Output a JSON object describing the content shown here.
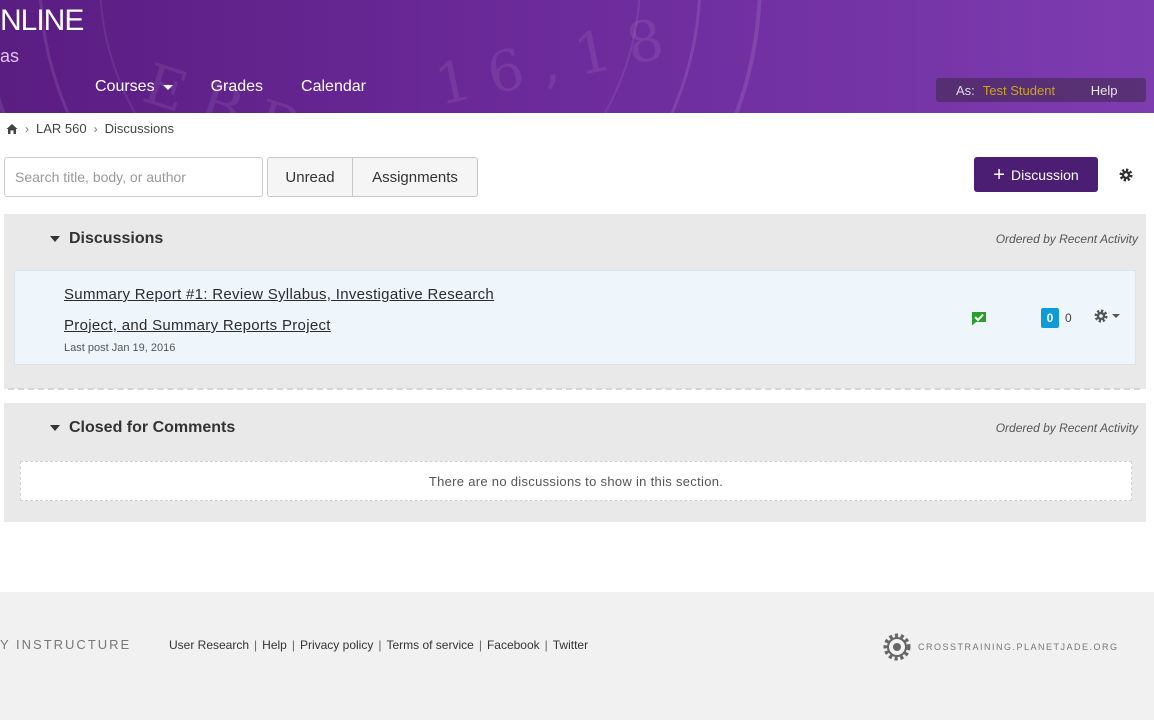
{
  "header": {
    "brand": "NLINE",
    "brand_sub": "as",
    "nav": [
      {
        "label": "Courses"
      },
      {
        "label": "Grades"
      },
      {
        "label": "Calendar"
      }
    ],
    "user_bar": {
      "as_label": "As:",
      "user_name": "Test Student",
      "help": "Help"
    },
    "accent_color": "#5a1d82"
  },
  "breadcrumb": {
    "items": [
      "LAR 560",
      "Discussions"
    ]
  },
  "toolbar": {
    "search_placeholder": "Search title, body, or author",
    "unread_label": "Unread",
    "assignments_label": "Assignments",
    "add_label": "Discussion",
    "add_color": "#4b1e74"
  },
  "sections": {
    "discussions": {
      "title": "Discussions",
      "order": "Ordered by Recent Activity",
      "items": [
        {
          "title": "Summary Report #1: Review Syllabus, Investigative Research Project, and Summary Reports Project",
          "last_post": "Last post Jan 19, 2016",
          "unread_count": "0",
          "total_count": "0"
        }
      ]
    },
    "closed": {
      "title": "Closed for Comments",
      "order": "Ordered by Recent Activity",
      "empty_text": "There are no discussions to show in this section."
    }
  },
  "footer": {
    "brand": "Y INSTRUCTURE",
    "links": [
      "User Research",
      "Help",
      "Privacy policy",
      "Terms of service",
      "Facebook",
      "Twitter"
    ],
    "logo_text": "CROSSTRAINING.PLANETJADE.ORG"
  }
}
